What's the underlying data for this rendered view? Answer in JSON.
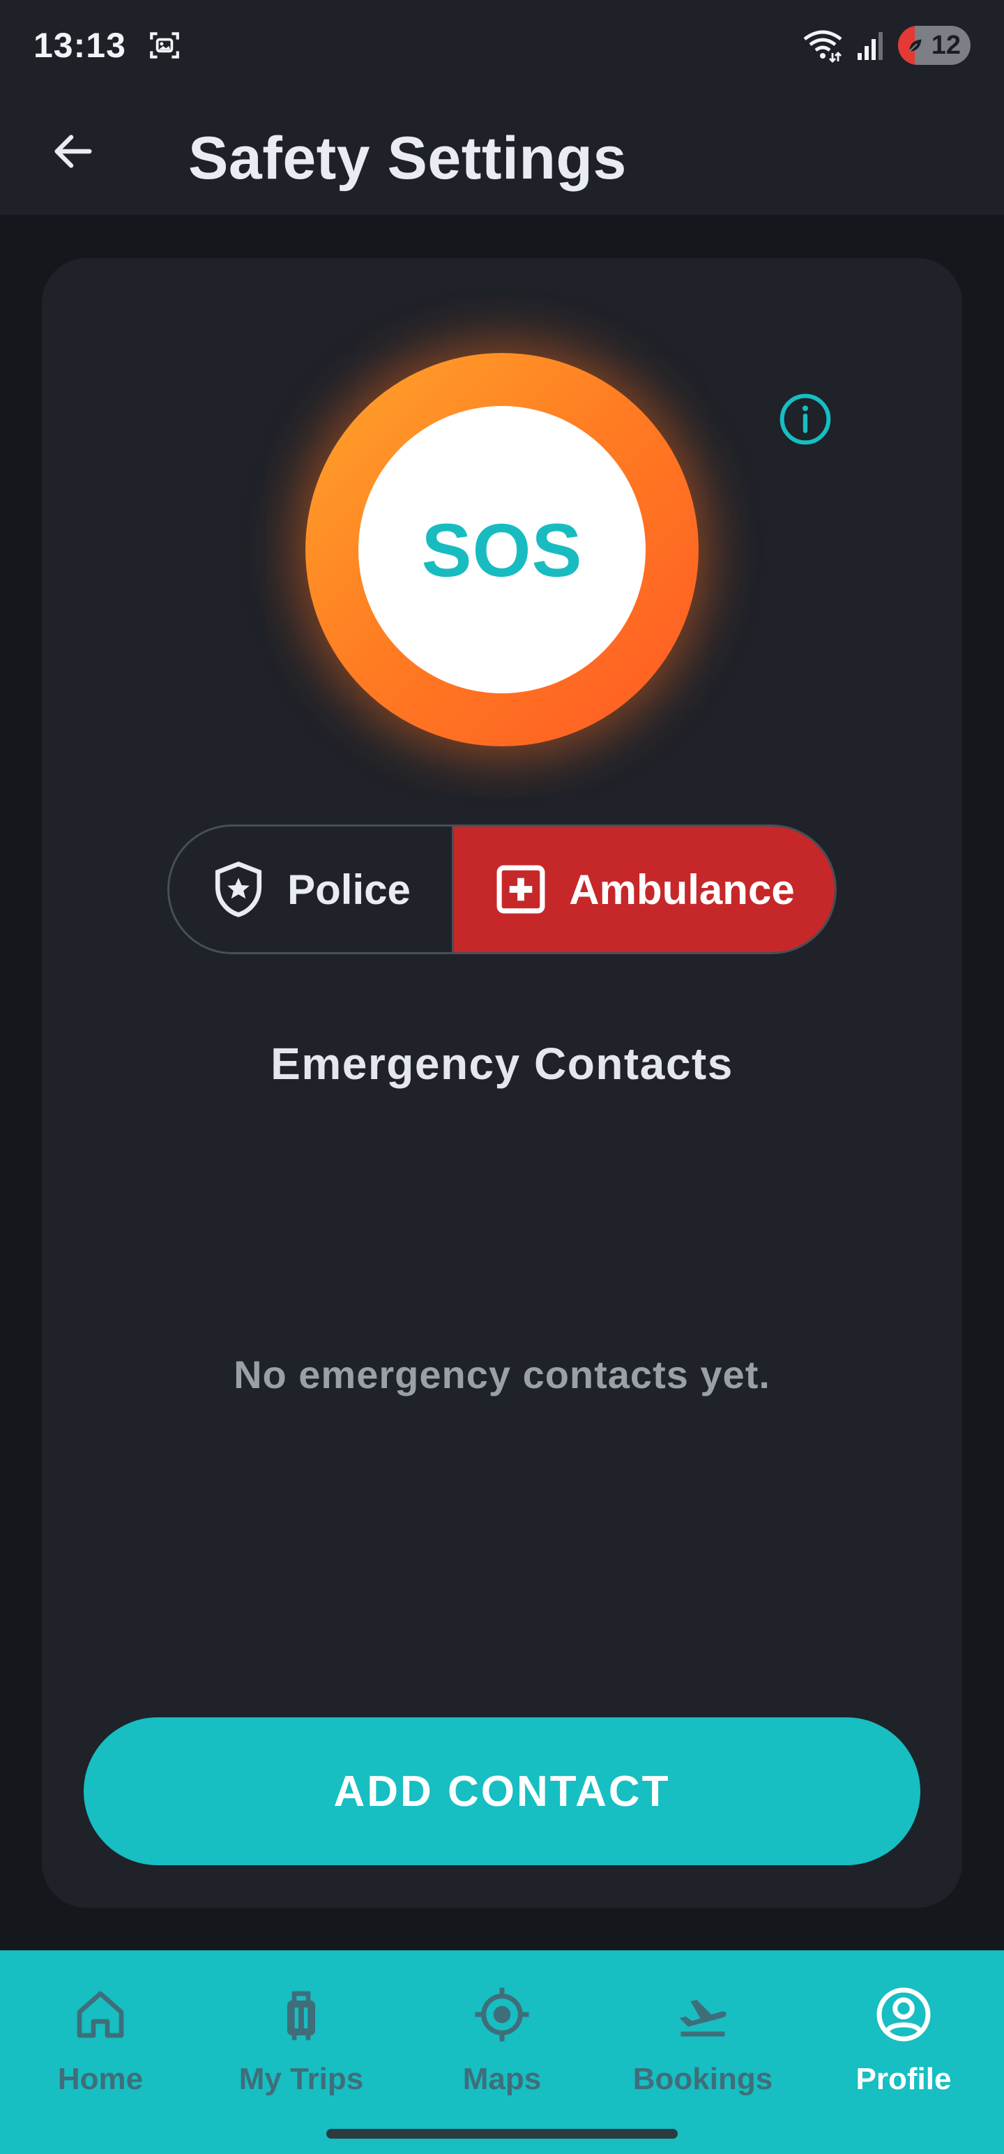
{
  "status_bar": {
    "time": "13:13",
    "battery_level": "12"
  },
  "app_bar": {
    "title": "Safety Settings"
  },
  "sos": {
    "label": "SOS"
  },
  "emergency_services": {
    "options": [
      {
        "label": "Police",
        "icon": "police-shield-icon",
        "selected": false
      },
      {
        "label": "Ambulance",
        "icon": "medical-cross-icon",
        "selected": true
      }
    ]
  },
  "contacts": {
    "heading": "Emergency Contacts",
    "empty_message": "No emergency contacts yet.",
    "add_button": "ADD CONTACT"
  },
  "bottom_nav": {
    "items": [
      {
        "label": "Home",
        "icon": "home-icon",
        "active": false
      },
      {
        "label": "My Trips",
        "icon": "luggage-icon",
        "active": false
      },
      {
        "label": "Maps",
        "icon": "location-target-icon",
        "active": false
      },
      {
        "label": "Bookings",
        "icon": "flight-takeoff-icon",
        "active": false
      },
      {
        "label": "Profile",
        "icon": "profile-icon",
        "active": true
      }
    ]
  },
  "colors": {
    "accent": "#17bec2",
    "sos_gradient_start": "#ffa52b",
    "sos_gradient_end": "#ff5a24",
    "ambulance_selected": "#c6282a",
    "background": "#14171c",
    "surface": "#1f2229"
  }
}
